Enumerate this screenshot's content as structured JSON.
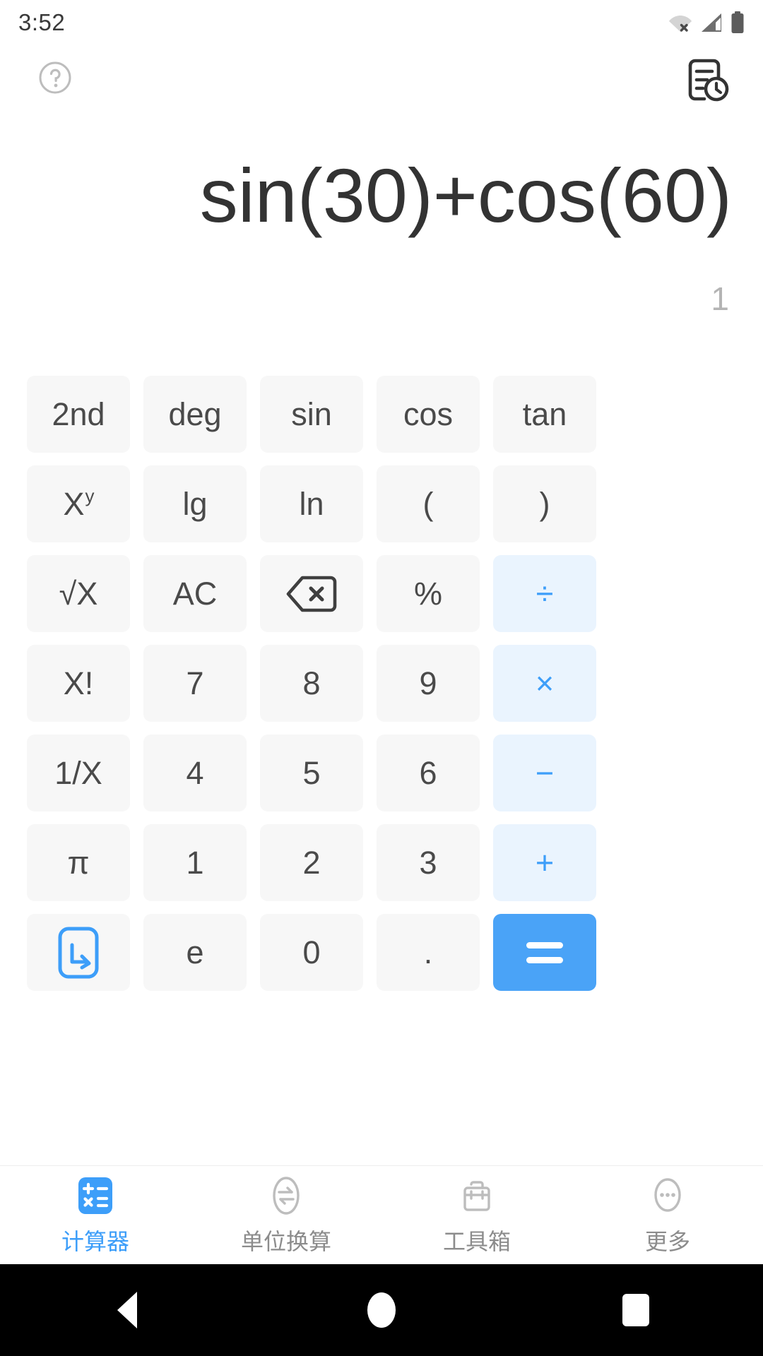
{
  "statusbar": {
    "time": "3:52",
    "icons": [
      "wifi-off-icon",
      "cellular-signal-icon",
      "battery-icon"
    ]
  },
  "actionbar": {
    "help_icon": "help-circle-icon",
    "history_icon": "history-document-icon"
  },
  "display": {
    "expression": "sin(30)+cos(60)",
    "result": "1"
  },
  "colors": {
    "accent": "#3d9ef9",
    "equals_bg": "#4aa3f7",
    "operator_bg": "#eaf4fe",
    "key_bg": "#f7f7f7",
    "key_text": "#4a4a4a",
    "expression_text": "#333333",
    "result_text": "#b4b4b4"
  },
  "keypad": {
    "rows": [
      [
        {
          "label": "2nd",
          "kind": "fn",
          "name": "key-2nd"
        },
        {
          "label": "deg",
          "kind": "fn",
          "name": "key-deg"
        },
        {
          "label": "sin",
          "kind": "fn",
          "name": "key-sin"
        },
        {
          "label": "cos",
          "kind": "fn",
          "name": "key-cos"
        },
        {
          "label": "tan",
          "kind": "fn",
          "name": "key-tan"
        }
      ],
      [
        {
          "label": "X",
          "sup": "y",
          "kind": "fn",
          "name": "key-power"
        },
        {
          "label": "lg",
          "kind": "fn",
          "name": "key-lg"
        },
        {
          "label": "ln",
          "kind": "fn",
          "name": "key-ln"
        },
        {
          "label": "(",
          "kind": "fn",
          "name": "key-open-paren"
        },
        {
          "label": ")",
          "kind": "fn",
          "name": "key-close-paren"
        }
      ],
      [
        {
          "label": "√X",
          "kind": "fn",
          "name": "key-sqrt"
        },
        {
          "label": "AC",
          "kind": "fn",
          "name": "key-all-clear"
        },
        {
          "label": "",
          "kind": "icon",
          "icon": "backspace-icon",
          "name": "key-backspace"
        },
        {
          "label": "%",
          "kind": "fn",
          "name": "key-percent"
        },
        {
          "label": "÷",
          "kind": "op",
          "name": "key-divide"
        }
      ],
      [
        {
          "label": "X!",
          "kind": "fn",
          "name": "key-factorial"
        },
        {
          "label": "7",
          "kind": "num",
          "name": "key-7"
        },
        {
          "label": "8",
          "kind": "num",
          "name": "key-8"
        },
        {
          "label": "9",
          "kind": "num",
          "name": "key-9"
        },
        {
          "label": "×",
          "kind": "op",
          "name": "key-multiply"
        }
      ],
      [
        {
          "label": "1/X",
          "kind": "fn",
          "name": "key-reciprocal"
        },
        {
          "label": "4",
          "kind": "num",
          "name": "key-4"
        },
        {
          "label": "5",
          "kind": "num",
          "name": "key-5"
        },
        {
          "label": "6",
          "kind": "num",
          "name": "key-6"
        },
        {
          "label": "−",
          "kind": "op",
          "name": "key-minus"
        }
      ],
      [
        {
          "label": "π",
          "kind": "fn",
          "name": "key-pi"
        },
        {
          "label": "1",
          "kind": "num",
          "name": "key-1"
        },
        {
          "label": "2",
          "kind": "num",
          "name": "key-2"
        },
        {
          "label": "3",
          "kind": "num",
          "name": "key-3"
        },
        {
          "label": "+",
          "kind": "op",
          "name": "key-plus"
        }
      ],
      [
        {
          "label": "",
          "kind": "icon",
          "icon": "hide-keyboard-icon",
          "name": "key-hide-keyboard"
        },
        {
          "label": "e",
          "kind": "fn",
          "name": "key-euler"
        },
        {
          "label": "0",
          "kind": "num",
          "name": "key-0"
        },
        {
          "label": ".",
          "kind": "num",
          "name": "key-decimal"
        },
        {
          "label": "=",
          "kind": "equals",
          "name": "key-equals"
        }
      ]
    ]
  },
  "tabbar": {
    "items": [
      {
        "label": "计算器",
        "icon": "calculator-icon",
        "active": true,
        "name": "tab-calculator"
      },
      {
        "label": "单位换算",
        "icon": "unit-convert-icon",
        "active": false,
        "name": "tab-unit-conversion"
      },
      {
        "label": "工具箱",
        "icon": "toolbox-icon",
        "active": false,
        "name": "tab-toolbox"
      },
      {
        "label": "更多",
        "icon": "more-ellipsis-icon",
        "active": false,
        "name": "tab-more"
      }
    ]
  },
  "navbar": {
    "back": "back-triangle-icon",
    "home": "home-circle-icon",
    "recent": "recent-square-icon"
  }
}
